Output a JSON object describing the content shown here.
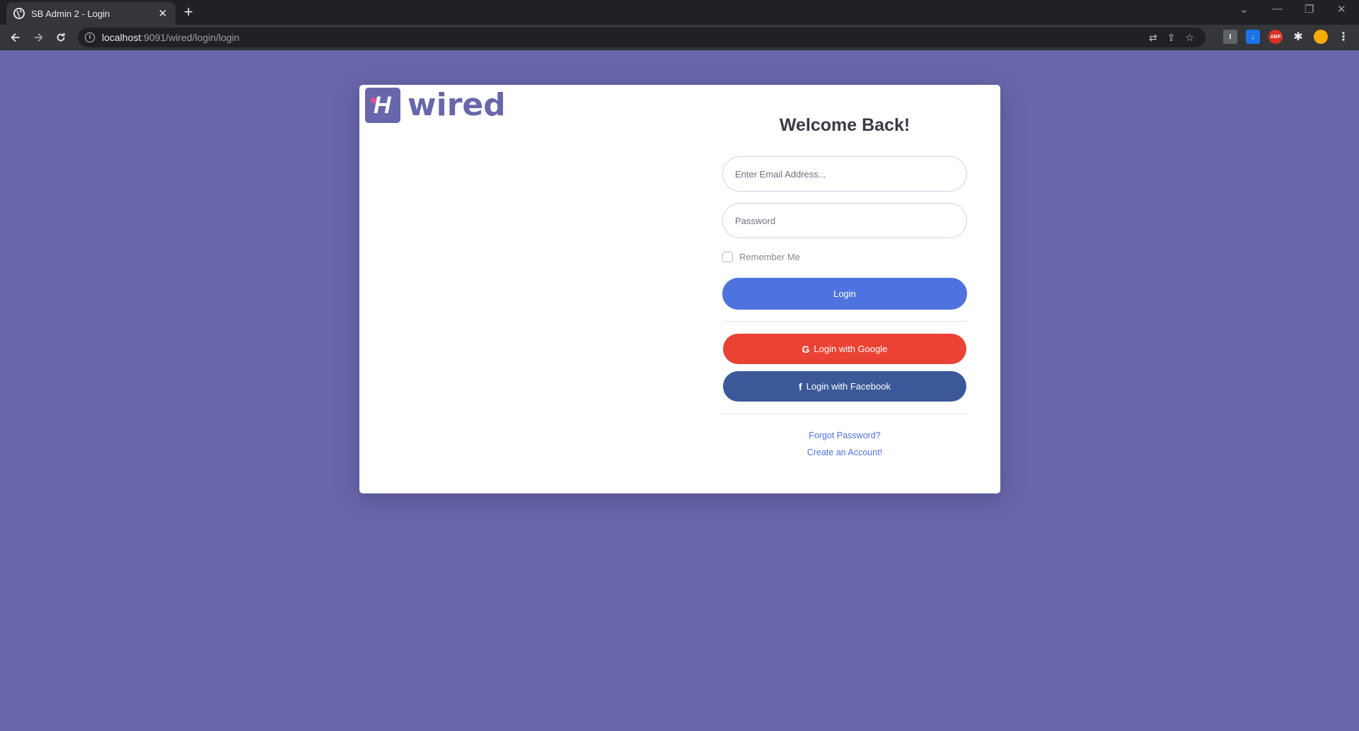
{
  "browser": {
    "tab_title": "SB Admin 2 - Login",
    "tab_close": "✕",
    "new_tab": "+",
    "url_host": "localhost",
    "url_path": ":9091/wired/login/login",
    "win_min": "—",
    "win_restore": "❐",
    "win_close": "✕",
    "win_dropdown": "⌄",
    "ext_abp": "ABP"
  },
  "brand": {
    "logo_letter": "H",
    "logo_text": "wired",
    "primary_color": "#6967ab"
  },
  "login": {
    "heading": "Welcome Back!",
    "email_placeholder": "Enter Email Address...",
    "password_placeholder": "Password",
    "remember_label": "Remember Me",
    "login_button": "Login",
    "google_icon": "G",
    "google_button": "Login with Google",
    "facebook_icon": "f",
    "facebook_button": "Login with Facebook",
    "forgot_link": "Forgot Password?",
    "create_link": "Create an Account!"
  },
  "colors": {
    "login": "#4e73df",
    "google": "#ea4335",
    "facebook": "#3b5998"
  }
}
